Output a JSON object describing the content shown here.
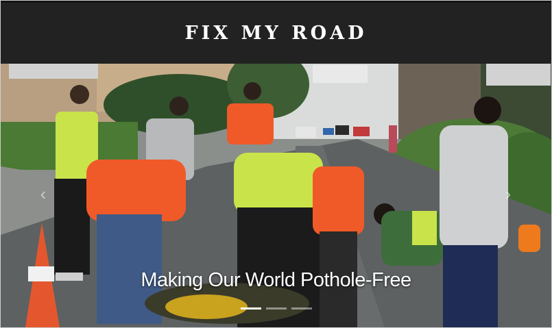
{
  "header": {
    "title": "FIX MY ROAD"
  },
  "hero": {
    "caption": "Making Our World Pothole-Free",
    "prev_arrow": "‹",
    "next_arrow": "›",
    "slides_total": 3,
    "active_slide": 1
  },
  "colors": {
    "header_bg": "#222222",
    "header_text": "#ffffff",
    "vest_orange": "#f05a28",
    "vest_yellow": "#c9e34a",
    "cone_orange": "#e4572e"
  }
}
